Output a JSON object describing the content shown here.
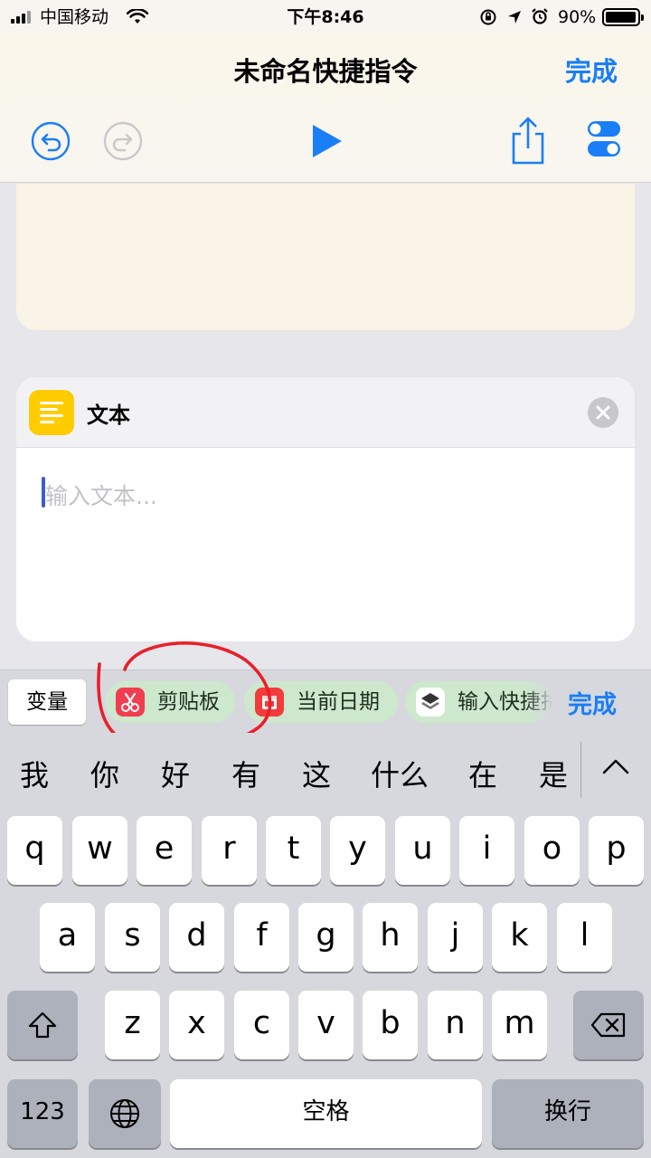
{
  "status_bar": {
    "carrier": "中国移动",
    "time": "下午8:46",
    "battery": "90%"
  },
  "nav": {
    "title": "未命名快捷指令",
    "done": "完成"
  },
  "toolbar": {
    "undo_icon": "undo-icon",
    "redo_icon": "redo-icon",
    "run_icon": "play-icon",
    "share_icon": "share-icon",
    "settings_icon": "toggle-settings-icon"
  },
  "text_action": {
    "title": "文本",
    "placeholder": "输入文本..."
  },
  "variables_bar": {
    "variables_label": "变量",
    "chips": [
      {
        "label": "剪贴板",
        "icon": "scissors-icon",
        "color": "#f23c50"
      },
      {
        "label": "当前日期",
        "icon": "calendar-icon",
        "color": "#f23c3c"
      },
      {
        "label": "输入快捷指令",
        "icon": "layers-icon",
        "color": "#ffffff"
      }
    ],
    "done": "完成"
  },
  "candidates": [
    "我",
    "你",
    "好",
    "有",
    "这",
    "什么",
    "在",
    "是"
  ],
  "keyboard": {
    "row1": [
      "q",
      "w",
      "e",
      "r",
      "t",
      "y",
      "u",
      "i",
      "o",
      "p"
    ],
    "row2": [
      "a",
      "s",
      "d",
      "f",
      "g",
      "h",
      "j",
      "k",
      "l"
    ],
    "row3": [
      "z",
      "x",
      "c",
      "v",
      "b",
      "n",
      "m"
    ],
    "numbers": "123",
    "space": "空格",
    "return": "换行"
  },
  "colors": {
    "accent": "#1a7ef7",
    "annotation": "#e8202a",
    "chip_bg": "#cde8cc"
  }
}
